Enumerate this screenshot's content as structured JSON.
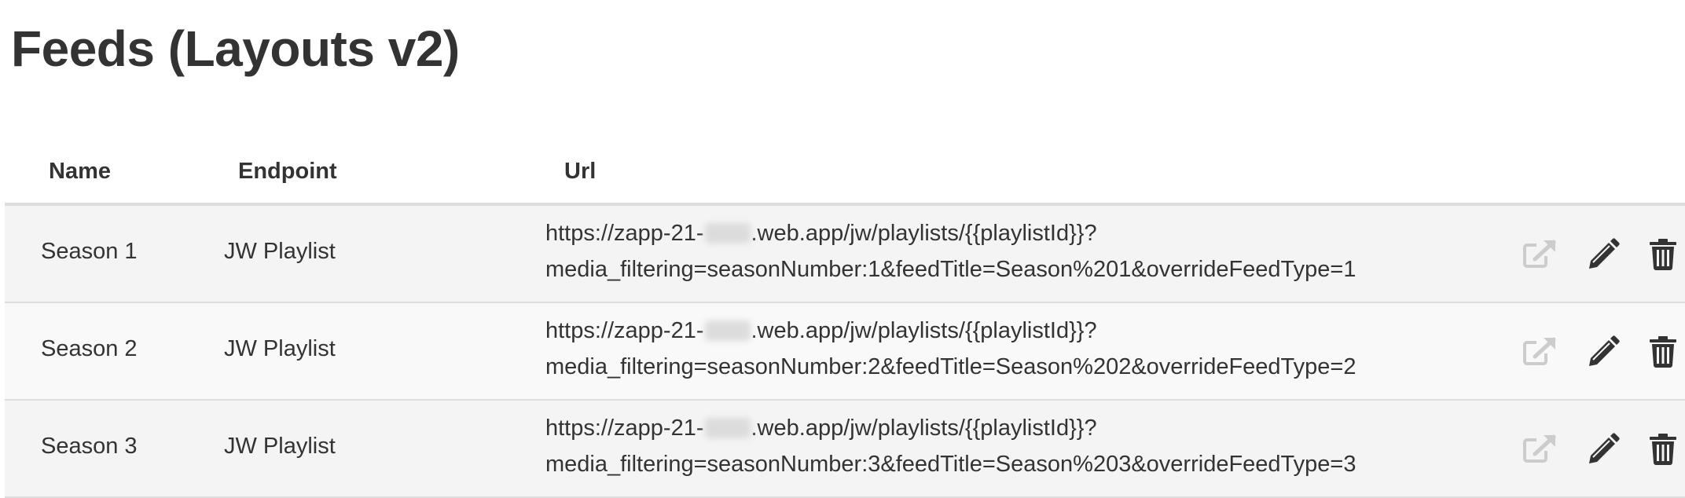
{
  "page": {
    "title": "Feeds (Layouts v2)"
  },
  "table": {
    "columns": {
      "name": "Name",
      "endpoint": "Endpoint",
      "url": "Url"
    },
    "rows": [
      {
        "name": "Season 1",
        "endpoint": "JW Playlist",
        "url_line1_prefix": "https://zapp-21-",
        "url_line1_suffix": ".web.app/jw/playlists/{{playlistId}}?",
        "url_line2": "media_filtering=seasonNumber:1&feedTitle=Season%201&overrideFeedType=1"
      },
      {
        "name": "Season 2",
        "endpoint": "JW Playlist",
        "url_line1_prefix": "https://zapp-21-",
        "url_line1_suffix": ".web.app/jw/playlists/{{playlistId}}?",
        "url_line2": "media_filtering=seasonNumber:2&feedTitle=Season%202&overrideFeedType=2"
      },
      {
        "name": "Season 3",
        "endpoint": "JW Playlist",
        "url_line1_prefix": "https://zapp-21-",
        "url_line1_suffix": ".web.app/jw/playlists/{{playlistId}}?",
        "url_line2": "media_filtering=seasonNumber:3&feedTitle=Season%203&overrideFeedType=3"
      }
    ],
    "row_actions": [
      "external-link-icon",
      "pencil-icon",
      "trash-icon"
    ]
  },
  "colors": {
    "text": "#333333",
    "icon_muted": "#cccccc",
    "icon_dark": "#333333",
    "row_odd": "#f4f4f4",
    "row_even": "#f9f9f9",
    "border": "#dddddd"
  }
}
